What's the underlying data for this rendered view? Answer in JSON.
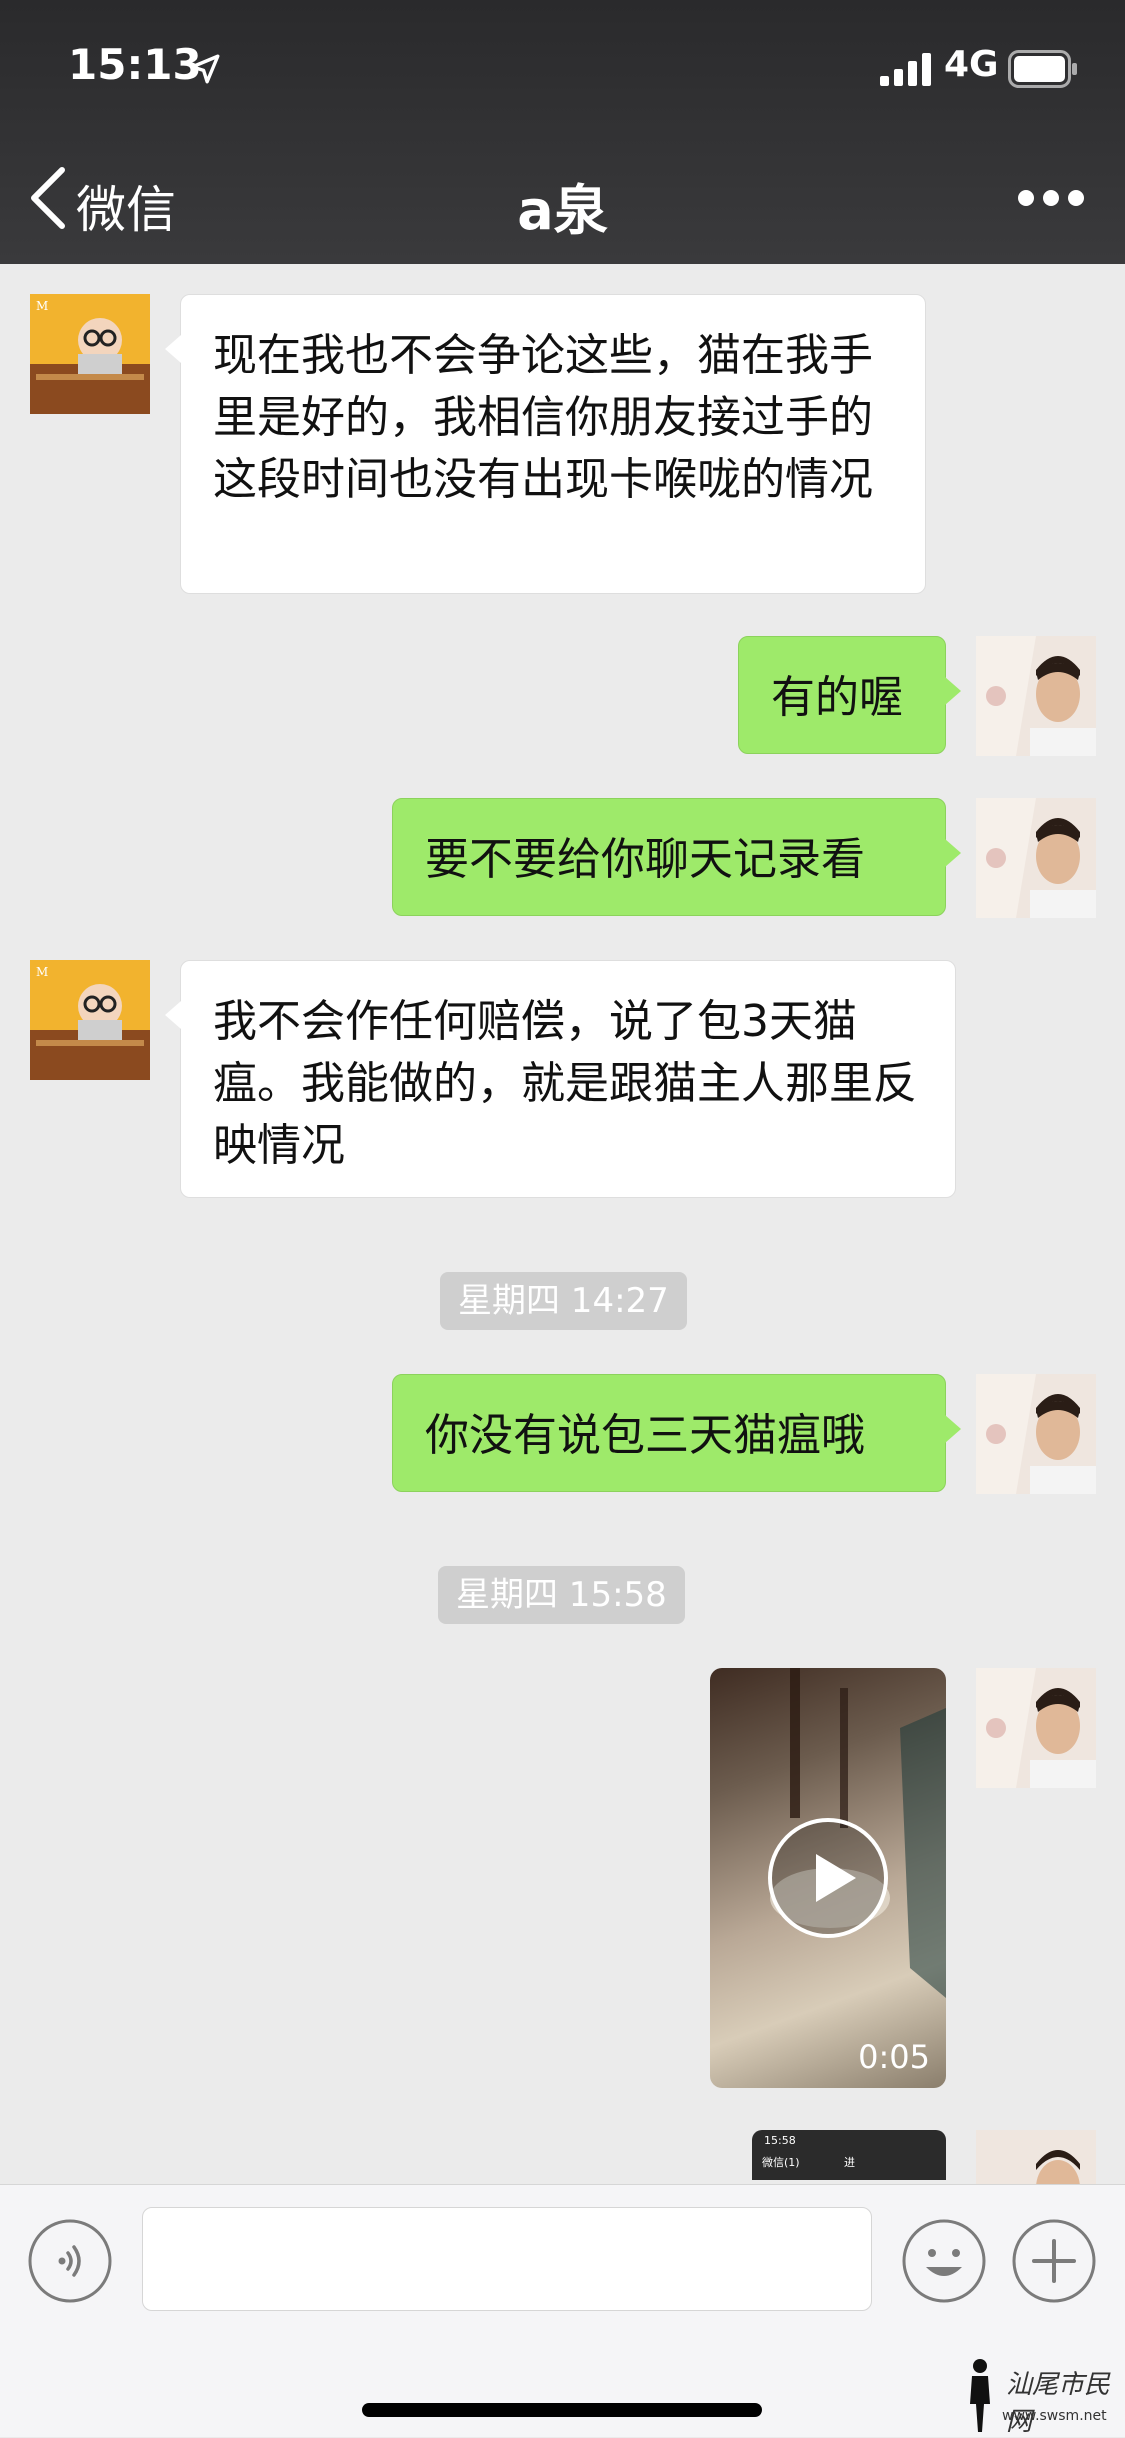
{
  "status_bar": {
    "time": "15:13",
    "network": "4G"
  },
  "nav": {
    "back_label": "微信",
    "title": "a泉"
  },
  "messages": [
    {
      "side": "left",
      "text": "现在我也不会争论这些，猫在我手里是好的，我相信你朋友接过手的这段时间也没有出现卡喉咙的情况"
    },
    {
      "side": "right",
      "text": "有的喔"
    },
    {
      "side": "right",
      "text": "要不要给你聊天记录看"
    },
    {
      "side": "left",
      "text": "我不会作任何赔偿，说了包3天猫瘟。我能做的，就是跟猫主人那里反映情况"
    },
    {
      "side": "right",
      "text": "你没有说包三天猫瘟哦"
    }
  ],
  "timestamps": [
    "星期四 14:27",
    "星期四 15:58"
  ],
  "video": {
    "duration": "0:05"
  },
  "screenshot_preview": {
    "time": "15:58",
    "back": "微信(1)",
    "name": "进"
  },
  "watermark": {
    "text": "汕尾市民网",
    "url": "www.swsm.net"
  },
  "colors": {
    "green_bubble": "#9eea6a",
    "white_bubble": "#ffffff",
    "background": "#ebebeb",
    "header": "#333333"
  },
  "icons": [
    "location-arrow-icon",
    "signal-icon",
    "battery-icon",
    "chevron-left-icon",
    "more-icon",
    "play-icon",
    "voice-icon",
    "emoji-icon",
    "plus-icon"
  ]
}
